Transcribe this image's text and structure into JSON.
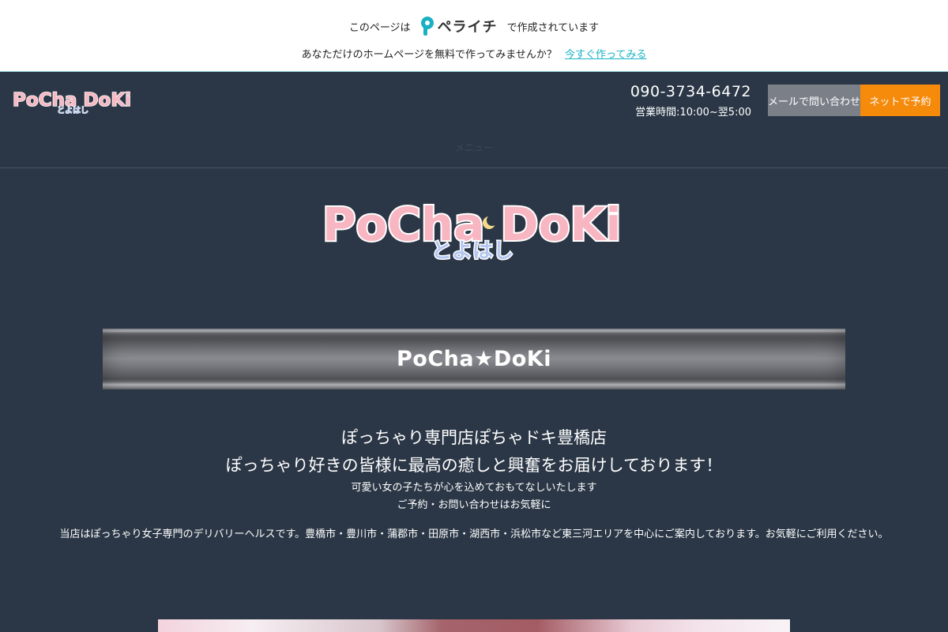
{
  "banner": {
    "left_text": "このページは",
    "brand": "ペライチ",
    "right_text": "で作成されています",
    "sub_text": "あなただけのホームページを無料で作ってみませんか？",
    "link_text": "今すぐ作ってみる"
  },
  "header": {
    "logo_text": "PoCha DoKi",
    "logo_sub": "とよはし",
    "phone": "090-3734-6472",
    "hours": "営業時間:10:00~翌5:00",
    "btn_contact": "メールで問い合わせ",
    "btn_reserve": "ネットで予約",
    "nav_faint": "メニュー"
  },
  "hero": {
    "logo_text": "PoCha DoKi",
    "logo_sub": "とよはし"
  },
  "title_band": {
    "title": "PoCha★DoKi"
  },
  "intro": {
    "line1": "ぽっちゃり専門店ぽちゃドキ豊橋店",
    "line2": "ぽっちゃり好きの皆様に最高の癒しと興奮をお届けしております！",
    "line3": "可愛い女の子たちが心を込めておもてなしいたします",
    "line4": "ご予約・お問い合わせはお気軽に",
    "line5": "当店はぽっちゃり女子専門のデリバリーヘルスです。豊橋市・豊川市・蒲郡市・田原市・湖西市・浜松市など東三河エリアを中心にご案内しております。お気軽にご利用ください。"
  },
  "colors": {
    "page_bg": "#2b3746",
    "accent_orange": "#f58a0b",
    "button_gray": "#7b7f88",
    "link_teal": "#19b3c6"
  }
}
